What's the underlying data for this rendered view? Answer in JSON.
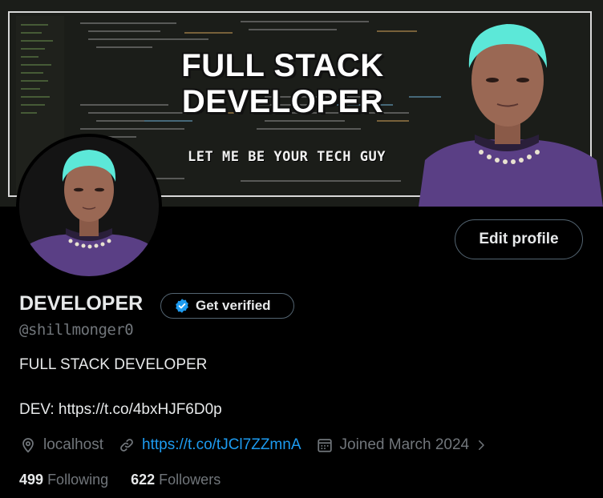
{
  "banner": {
    "title": "FULL STACK DEVELOPER",
    "subtitle": "LET ME BE YOUR TECH GUY"
  },
  "profile": {
    "edit_label": "Edit profile",
    "name": "DEVELOPER",
    "verify_label": "Get verified",
    "handle": "@shillmonger0",
    "bio_line1": "FULL STACK DEVELOPER",
    "bio_line2": "DEV: https://t.co/4bxHJF6D0p",
    "location": "localhost",
    "website": "https://t.co/tJCl7ZZmnA",
    "joined": "Joined March 2024",
    "following_count": "499",
    "following_label": "Following",
    "followers_count": "622",
    "followers_label": "Followers"
  },
  "colors": {
    "accent": "#1d9bf0",
    "muted": "#71767b",
    "text": "#e7e9ea",
    "hair": "#5ce8d8",
    "shirt": "#5a3f85"
  },
  "icons": {
    "verified": "verified-badge-icon",
    "location": "location-pin-icon",
    "link": "link-icon",
    "calendar": "calendar-icon",
    "chevron": "chevron-right-icon"
  }
}
